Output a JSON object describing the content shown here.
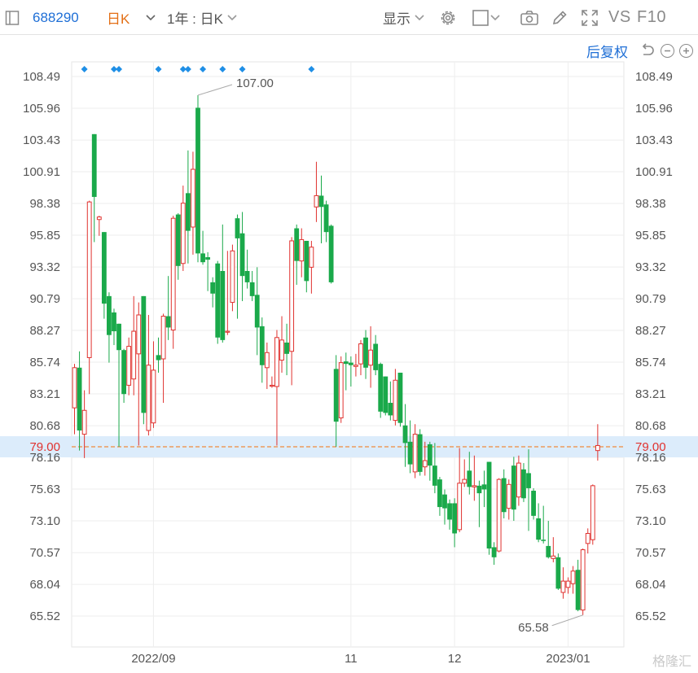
{
  "toolbar": {
    "stock_code": "688290",
    "period": "日K",
    "range_label": "1年 : 日K",
    "display_label": "显示",
    "vs_label": "VS",
    "f10_label": "F10",
    "restore_label": "后复权"
  },
  "watermark": "格隆汇",
  "colors": {
    "up": "#e0322f",
    "down": "#1aa94a",
    "marker": "#1f8fe6",
    "guide": "#f08a3c",
    "highlight": "#dcecfb"
  },
  "chart_data": {
    "type": "candlestick",
    "y_ticks": [
      "108.49",
      "105.96",
      "103.43",
      "100.91",
      "98.38",
      "95.85",
      "93.32",
      "90.79",
      "88.27",
      "85.74",
      "83.21",
      "80.68",
      "78.16",
      "75.63",
      "73.10",
      "70.57",
      "68.04",
      "65.52"
    ],
    "ylim": [
      65.52,
      108.49
    ],
    "x_labels": [
      "2022/09",
      "11",
      "12",
      "2023/01"
    ],
    "current_price": "79.00",
    "annotations": {
      "high": "107.00",
      "low": "65.58"
    },
    "candles": [
      {
        "o": 82.1,
        "h": 85.6,
        "c": 85.3,
        "l": 80.0
      },
      {
        "o": 85.3,
        "h": 86.6,
        "c": 80.3,
        "l": 78.7
      },
      {
        "o": 80.0,
        "h": 83.5,
        "c": 81.9,
        "l": 78.1
      },
      {
        "o": 86.1,
        "h": 98.6,
        "c": 98.5,
        "l": 83.2
      },
      {
        "o": 103.9,
        "h": 103.9,
        "c": 98.9,
        "l": 95.3
      },
      {
        "o": 97.1,
        "h": 97.4,
        "c": 97.3,
        "l": 95.8
      },
      {
        "o": 96.1,
        "h": 96.1,
        "c": 90.4,
        "l": 89.2
      },
      {
        "o": 91.0,
        "h": 91.3,
        "c": 87.9,
        "l": 85.7
      },
      {
        "o": 89.7,
        "h": 90.0,
        "c": 88.2,
        "l": 87.1
      },
      {
        "o": 88.8,
        "h": 88.8,
        "c": 86.7,
        "l": 79.0
      },
      {
        "o": 86.7,
        "h": 86.8,
        "c": 83.2,
        "l": 82.5
      },
      {
        "o": 83.9,
        "h": 87.7,
        "c": 87.0,
        "l": 83.1
      },
      {
        "o": 84.4,
        "h": 91.0,
        "c": 88.2,
        "l": 83.1
      },
      {
        "o": 86.4,
        "h": 90.5,
        "c": 89.5,
        "l": 79.1
      },
      {
        "o": 91.0,
        "h": 91.0,
        "c": 81.7,
        "l": 80.8
      },
      {
        "o": 80.3,
        "h": 89.5,
        "c": 85.5,
        "l": 79.9
      },
      {
        "o": 80.9,
        "h": 87.4,
        "c": 85.1,
        "l": 80.5
      },
      {
        "o": 86.3,
        "h": 87.7,
        "c": 85.9,
        "l": 84.9
      },
      {
        "o": 86.0,
        "h": 89.6,
        "c": 89.4,
        "l": 82.5
      },
      {
        "o": 89.4,
        "h": 92.6,
        "c": 88.5,
        "l": 87.5
      },
      {
        "o": 88.3,
        "h": 97.4,
        "c": 97.2,
        "l": 86.8
      },
      {
        "o": 97.5,
        "h": 97.6,
        "c": 93.4,
        "l": 92.3
      },
      {
        "o": 93.6,
        "h": 99.8,
        "c": 98.4,
        "l": 93.0
      },
      {
        "o": 99.2,
        "h": 102.6,
        "c": 96.2,
        "l": 93.6
      },
      {
        "o": 96.5,
        "h": 102.5,
        "c": 101.1,
        "l": 94.3
      },
      {
        "o": 106.0,
        "h": 107.0,
        "c": 94.4,
        "l": 93.7
      },
      {
        "o": 94.4,
        "h": 96.2,
        "c": 93.7,
        "l": 93.5
      },
      {
        "o": 94.1,
        "h": 94.5,
        "c": 93.9,
        "l": 91.4
      },
      {
        "o": 92.1,
        "h": 92.5,
        "c": 91.2,
        "l": 90.1
      },
      {
        "o": 93.6,
        "h": 93.8,
        "c": 87.7,
        "l": 87.2
      },
      {
        "o": 93.0,
        "h": 96.7,
        "c": 87.5,
        "l": 87.3
      },
      {
        "o": 88.2,
        "h": 94.6,
        "c": 88.2,
        "l": 87.9
      },
      {
        "o": 90.5,
        "h": 95.1,
        "c": 94.6,
        "l": 89.8
      },
      {
        "o": 97.2,
        "h": 97.5,
        "c": 95.6,
        "l": 89.2
      },
      {
        "o": 96.0,
        "h": 97.7,
        "c": 92.6,
        "l": 90.6
      },
      {
        "o": 93.0,
        "h": 94.7,
        "c": 92.1,
        "l": 91.6
      },
      {
        "o": 92.1,
        "h": 93.0,
        "c": 91.0,
        "l": 90.6
      },
      {
        "o": 91.1,
        "h": 93.3,
        "c": 88.5,
        "l": 86.3
      },
      {
        "o": 88.6,
        "h": 89.3,
        "c": 85.5,
        "l": 84.1
      },
      {
        "o": 85.3,
        "h": 87.3,
        "c": 86.5,
        "l": 83.6
      },
      {
        "o": 83.9,
        "h": 84.6,
        "c": 83.9,
        "l": 83.7
      },
      {
        "o": 83.8,
        "h": 88.3,
        "c": 87.7,
        "l": 79.1
      },
      {
        "o": 85.9,
        "h": 89.4,
        "c": 87.5,
        "l": 84.9
      },
      {
        "o": 87.3,
        "h": 88.8,
        "c": 86.4,
        "l": 84.7
      },
      {
        "o": 86.6,
        "h": 95.7,
        "c": 95.4,
        "l": 83.9
      },
      {
        "o": 96.4,
        "h": 96.7,
        "c": 93.8,
        "l": 91.9
      },
      {
        "o": 93.8,
        "h": 96.4,
        "c": 95.5,
        "l": 92.5
      },
      {
        "o": 95.4,
        "h": 95.4,
        "c": 92.2,
        "l": 91.3
      },
      {
        "o": 93.3,
        "h": 95.4,
        "c": 94.9,
        "l": 91.2
      },
      {
        "o": 98.1,
        "h": 101.7,
        "c": 99.0,
        "l": 96.9
      },
      {
        "o": 99.0,
        "h": 100.6,
        "c": 98.1,
        "l": 95.2
      },
      {
        "o": 98.3,
        "h": 98.6,
        "c": 96.1,
        "l": 95.3
      },
      {
        "o": 96.6,
        "h": 96.7,
        "c": 92.1,
        "l": 92.0
      },
      {
        "o": 85.2,
        "h": 86.3,
        "c": 81.0,
        "l": 79.0
      },
      {
        "o": 81.3,
        "h": 86.2,
        "c": 85.7,
        "l": 80.9
      },
      {
        "o": 85.8,
        "h": 86.5,
        "c": 85.6,
        "l": 83.5
      },
      {
        "o": 85.7,
        "h": 86.2,
        "c": 85.5,
        "l": 83.8
      },
      {
        "o": 85.4,
        "h": 86.4,
        "c": 85.5,
        "l": 84.6
      },
      {
        "o": 85.6,
        "h": 87.5,
        "c": 87.2,
        "l": 84.7
      },
      {
        "o": 87.7,
        "h": 88.3,
        "c": 85.3,
        "l": 84.4
      },
      {
        "o": 85.5,
        "h": 88.6,
        "c": 86.7,
        "l": 83.7
      },
      {
        "o": 87.2,
        "h": 87.9,
        "c": 85.1,
        "l": 84.7
      },
      {
        "o": 85.6,
        "h": 85.7,
        "c": 81.8,
        "l": 81.3
      },
      {
        "o": 84.6,
        "h": 84.6,
        "c": 81.7,
        "l": 81.5
      },
      {
        "o": 82.5,
        "h": 84.2,
        "c": 81.5,
        "l": 81.1
      },
      {
        "o": 81.1,
        "h": 85.2,
        "c": 84.3,
        "l": 80.7
      },
      {
        "o": 84.9,
        "h": 84.9,
        "c": 80.9,
        "l": 80.6
      },
      {
        "o": 80.7,
        "h": 82.4,
        "c": 79.3,
        "l": 77.4
      },
      {
        "o": 79.4,
        "h": 81.1,
        "c": 77.6,
        "l": 76.9
      },
      {
        "o": 77.0,
        "h": 80.8,
        "c": 80.0,
        "l": 76.5
      },
      {
        "o": 80.0,
        "h": 80.4,
        "c": 77.0,
        "l": 76.7
      },
      {
        "o": 77.4,
        "h": 79.4,
        "c": 77.9,
        "l": 76.7
      },
      {
        "o": 79.2,
        "h": 79.4,
        "c": 77.5,
        "l": 76.3
      },
      {
        "o": 77.5,
        "h": 79.3,
        "c": 75.9,
        "l": 75.3
      },
      {
        "o": 76.4,
        "h": 76.6,
        "c": 74.2,
        "l": 73.5
      },
      {
        "o": 75.2,
        "h": 75.6,
        "c": 74.1,
        "l": 72.8
      },
      {
        "o": 74.5,
        "h": 74.8,
        "c": 73.2,
        "l": 72.4
      },
      {
        "o": 74.5,
        "h": 74.9,
        "c": 72.1,
        "l": 71.0
      },
      {
        "o": 72.4,
        "h": 78.9,
        "c": 76.1,
        "l": 72.2
      },
      {
        "o": 76.1,
        "h": 78.0,
        "c": 76.4,
        "l": 75.8
      },
      {
        "o": 77.1,
        "h": 78.6,
        "c": 75.8,
        "l": 75.2
      },
      {
        "o": 75.8,
        "h": 78.3,
        "c": 75.9,
        "l": 74.7
      },
      {
        "o": 75.9,
        "h": 76.3,
        "c": 75.3,
        "l": 72.6
      },
      {
        "o": 76.0,
        "h": 77.1,
        "c": 75.6,
        "l": 74.2
      },
      {
        "o": 77.8,
        "h": 77.8,
        "c": 70.9,
        "l": 70.4
      },
      {
        "o": 71.0,
        "h": 71.4,
        "c": 70.2,
        "l": 69.6
      },
      {
        "o": 70.7,
        "h": 76.5,
        "c": 76.4,
        "l": 70.6
      },
      {
        "o": 76.5,
        "h": 77.2,
        "c": 73.8,
        "l": 73.3
      },
      {
        "o": 74.1,
        "h": 76.4,
        "c": 76.0,
        "l": 73.2
      },
      {
        "o": 77.5,
        "h": 78.2,
        "c": 74.0,
        "l": 73.1
      },
      {
        "o": 75.0,
        "h": 78.3,
        "c": 77.7,
        "l": 74.3
      },
      {
        "o": 77.2,
        "h": 77.7,
        "c": 74.9,
        "l": 74.6
      },
      {
        "o": 76.9,
        "h": 78.8,
        "c": 75.7,
        "l": 72.3
      },
      {
        "o": 75.5,
        "h": 75.7,
        "c": 73.5,
        "l": 73.2
      },
      {
        "o": 73.3,
        "h": 74.5,
        "c": 71.6,
        "l": 71.4
      },
      {
        "o": 71.6,
        "h": 74.3,
        "c": 71.5,
        "l": 71.3
      },
      {
        "o": 71.1,
        "h": 73.1,
        "c": 70.2,
        "l": 70.1
      },
      {
        "o": 70.1,
        "h": 71.8,
        "c": 70.3,
        "l": 69.8
      },
      {
        "o": 70.2,
        "h": 70.5,
        "c": 67.7,
        "l": 67.6
      },
      {
        "o": 67.4,
        "h": 69.4,
        "c": 68.3,
        "l": 66.9
      },
      {
        "o": 67.8,
        "h": 68.6,
        "c": 68.3,
        "l": 67.3
      },
      {
        "o": 68.1,
        "h": 69.5,
        "c": 69.1,
        "l": 67.3
      },
      {
        "o": 69.2,
        "h": 70.0,
        "c": 66.0,
        "l": 65.9
      },
      {
        "o": 66.0,
        "h": 70.9,
        "c": 70.8,
        "l": 65.6
      },
      {
        "o": 71.3,
        "h": 72.5,
        "c": 72.1,
        "l": 70.5
      },
      {
        "o": 71.6,
        "h": 76.0,
        "c": 75.9,
        "l": 71.2
      },
      {
        "o": 78.7,
        "h": 80.8,
        "c": 79.1,
        "l": 77.9
      }
    ],
    "marker_candles": [
      2,
      8,
      9,
      17,
      22,
      23,
      26,
      30,
      34,
      48
    ]
  }
}
